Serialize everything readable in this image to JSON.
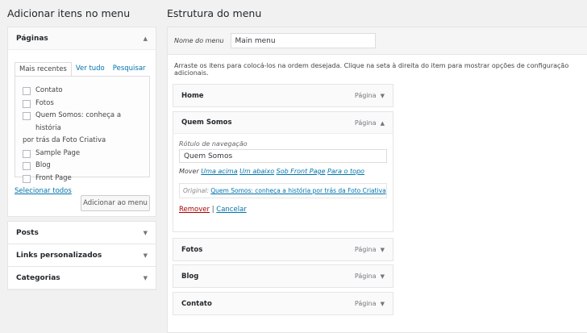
{
  "left": {
    "title": "Adicionar itens no menu",
    "pages": {
      "title": "Páginas",
      "tabs": [
        "Mais recentes",
        "Ver tudo",
        "Pesquisar"
      ],
      "items": [
        "Contato",
        "Fotos",
        "Quem Somos: conheça a história",
        "Sample Page",
        "Blog",
        "Front Page"
      ],
      "wrap": "por trás da Foto Criativa",
      "select_all": "Selecionar todos",
      "add_button": "Adicionar ao menu"
    },
    "sections": [
      "Posts",
      "Links personalizados",
      "Categorias"
    ]
  },
  "right": {
    "title": "Estrutura do menu",
    "menu_name_label": "Nome do menu",
    "menu_name_value": "Main menu",
    "instructions": "Arraste os itens para colocá-los na ordem desejada. Clique na seta à direita do item para mostrar opções de configuração adicionais.",
    "item_type": "Página",
    "items": [
      "Home",
      "Quem Somos",
      "Fotos",
      "Blog",
      "Contato"
    ],
    "expanded": {
      "nav_label": "Rótulo de navegação",
      "nav_value": "Quem Somos",
      "move_label": "Mover",
      "move_links": [
        "Uma acima",
        "Um abaixo",
        "Sob Front Page",
        "Para o topo"
      ],
      "original_label": "Original:",
      "original_link": "Quem Somos: conheça a história por trás da Foto Criativa",
      "remove": "Remover",
      "sep": "|",
      "cancel": "Cancelar"
    }
  }
}
